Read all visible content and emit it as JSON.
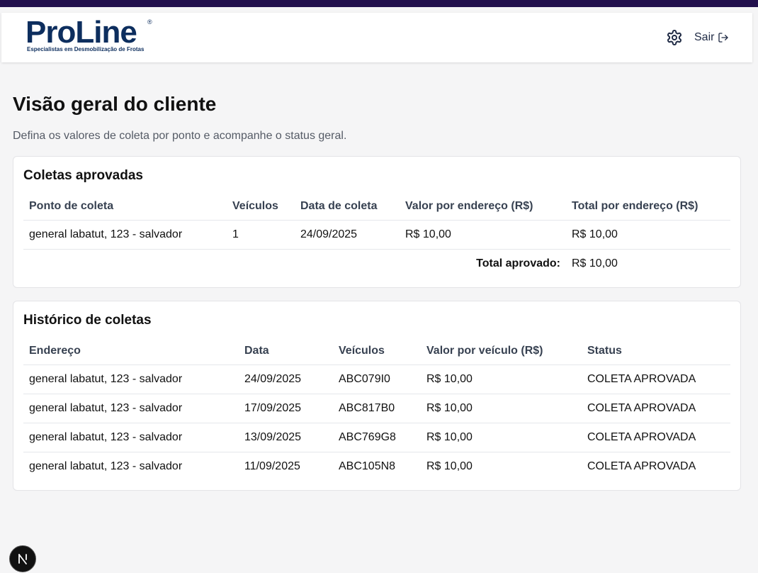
{
  "brand": {
    "name": "ProLine",
    "registered_mark": "®",
    "tagline": "Especialistas em Desmobilização de Frotas",
    "color_primary": "#0d2e5e",
    "color_strip": "#22104d"
  },
  "header": {
    "settings_icon": "gear-icon",
    "logout_label": "Sair",
    "logout_icon": "logout-icon"
  },
  "page": {
    "title": "Visão geral do cliente",
    "subtitle": "Defina os valores de coleta por ponto e acompanhe o status geral."
  },
  "approved": {
    "title": "Coletas aprovadas",
    "columns": [
      "Ponto de coleta",
      "Veículos",
      "Data de coleta",
      "Valor por endereço (R$)",
      "Total por endereço (R$)"
    ],
    "rows": [
      [
        "general labatut, 123 - salvador",
        "1",
        "24/09/2025",
        "R$ 10,00",
        "R$ 10,00"
      ]
    ],
    "total_label": "Total aprovado:",
    "total_value": "R$ 10,00"
  },
  "history": {
    "title": "Histórico de coletas",
    "columns": [
      "Endereço",
      "Data",
      "Veículos",
      "Valor por veículo (R$)",
      "Status"
    ],
    "rows": [
      [
        "general labatut, 123 - salvador",
        "24/09/2025",
        "ABC079I0",
        "R$ 10,00",
        "COLETA APROVADA"
      ],
      [
        "general labatut, 123 - salvador",
        "17/09/2025",
        "ABC817B0",
        "R$ 10,00",
        "COLETA APROVADA"
      ],
      [
        "general labatut, 123 - salvador",
        "13/09/2025",
        "ABC769G8",
        "R$ 10,00",
        "COLETA APROVADA"
      ],
      [
        "general labatut, 123 - salvador",
        "11/09/2025",
        "ABC105N8",
        "R$ 10,00",
        "COLETA APROVADA"
      ]
    ]
  },
  "dev_badge": {
    "letter": "N",
    "icon": "nextjs-icon"
  }
}
